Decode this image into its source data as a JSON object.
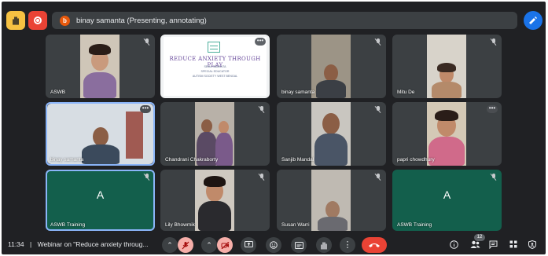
{
  "top_bar": {
    "presenter_initial": "b",
    "presenter_text": "binay samanta (Presenting, annotating)"
  },
  "slide": {
    "title": "REDUCE ANXIETY THROUGH PLAY",
    "line1": "SEMA SAMANTA",
    "line2": "SPECIAL EDUCATOR",
    "line3": "AUTISM SOCIETY WEST BENGAL"
  },
  "tiles": [
    {
      "name": "ASWB"
    },
    {
      "name": ""
    },
    {
      "name": "binay samanta"
    },
    {
      "name": "Mitu De"
    },
    {
      "name": "binay samanta"
    },
    {
      "name": "Chandrani Chakraborty"
    },
    {
      "name": "Sanjib Mandal"
    },
    {
      "name": "papri chowdhury"
    },
    {
      "name": "ASWB Training",
      "initial": "A"
    },
    {
      "name": "Lily Bhowmik"
    },
    {
      "name": "Susan Warri"
    },
    {
      "name": "ASWB Training",
      "initial": "A"
    }
  ],
  "bottom_bar": {
    "time": "11:34",
    "separator": "|",
    "meeting_title": "Webinar on \"Reduce anxiety throug...",
    "participant_count": "12"
  },
  "colors": {
    "background": "#202124",
    "tile": "#3c4043",
    "avatar_tile": "#135f4c",
    "hang_up": "#ea4335",
    "accent": "#1a73e8"
  }
}
